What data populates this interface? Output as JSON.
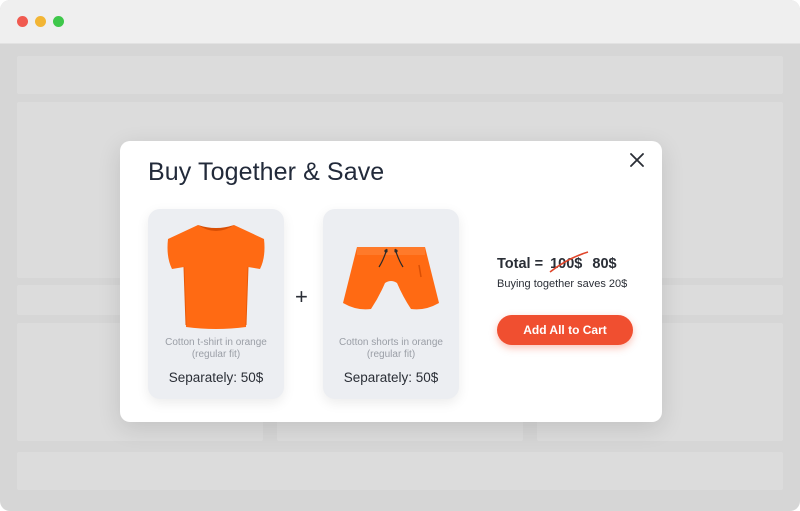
{
  "window": {
    "controls": [
      "close",
      "minimize",
      "zoom"
    ]
  },
  "modal": {
    "title": "Buy Together & Save",
    "close_icon": "close-icon",
    "plus_sign": "+",
    "products": [
      {
        "image_icon": "orange-tshirt-image",
        "description": "Cotton t-shirt in orange (regular fit)",
        "price": "Separately: 50$"
      },
      {
        "image_icon": "orange-shorts-image",
        "description": "Cotton shorts in orange (regular fit)",
        "price": "Separately: 50$"
      }
    ],
    "total": {
      "label": "Total =",
      "old_price": "100$",
      "new_price": "80$",
      "savings_text": "Buying together saves 20$"
    },
    "cta_label": "Add All to Cart"
  },
  "colors": {
    "accent": "#f04f30",
    "product": "#ff6a13",
    "text": "#222a3a"
  }
}
